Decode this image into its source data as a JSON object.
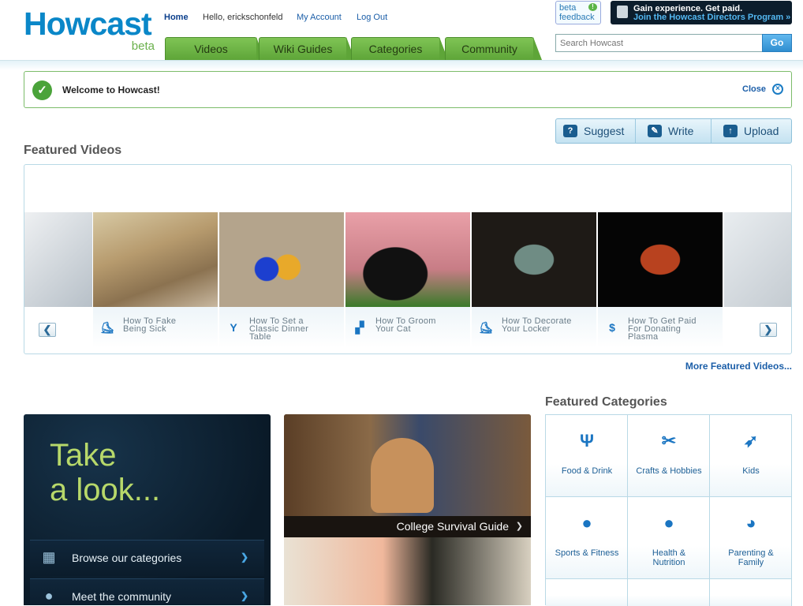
{
  "brand": {
    "name": "Howcast",
    "tag": "beta"
  },
  "topnav": {
    "home": "Home",
    "greeting": "Hello, erickschonfeld",
    "account": "My Account",
    "logout": "Log Out"
  },
  "tabs": [
    {
      "label": "Videos"
    },
    {
      "label": "Wiki Guides"
    },
    {
      "label": "Categories"
    },
    {
      "label": "Community"
    }
  ],
  "feedback": {
    "line1": "beta",
    "line2": "feedback"
  },
  "promo": {
    "line1": "Gain experience. Get paid.",
    "line2": "Join the Howcast Directors Program »"
  },
  "search": {
    "placeholder": "Search Howcast",
    "button": "Go"
  },
  "welcome": {
    "message": "Welcome to Howcast!",
    "close": "Close"
  },
  "actions": [
    {
      "label": "Suggest",
      "icon": "question-icon"
    },
    {
      "label": "Write",
      "icon": "pencil-icon"
    },
    {
      "label": "Upload",
      "icon": "upload-icon"
    }
  ],
  "featured": {
    "title": "Featured Videos",
    "more": "More Featured Videos...",
    "videos": [
      {
        "line1": "How To Fake",
        "line2": "Being Sick",
        "line3": "",
        "icon": "skateboard-icon"
      },
      {
        "line1": "How To Set a",
        "line2": "Classic Dinner",
        "line3": "Table",
        "icon": "glass-icon"
      },
      {
        "line1": "How To Groom",
        "line2": "Your Cat",
        "line3": "",
        "icon": "dog-icon"
      },
      {
        "line1": "How To Decorate",
        "line2": "Your Locker",
        "line3": "",
        "icon": "skateboard-icon"
      },
      {
        "line1": "How To Get Paid",
        "line2": "For Donating",
        "line3": "Plasma",
        "icon": "money-icon"
      }
    ]
  },
  "take_look": {
    "line1": "Take",
    "line2": "a look...",
    "rows": [
      {
        "label": "Browse our categories",
        "icon": "grid-icon"
      },
      {
        "label": "Meet the community",
        "icon": "person-icon"
      }
    ]
  },
  "college": {
    "caption": "College Survival Guide"
  },
  "categories": {
    "title": "Featured Categories",
    "items": [
      {
        "line1": "Food & Drink",
        "line2": "",
        "icon": "fork-knife-icon"
      },
      {
        "line1": "Crafts & Hobbies",
        "line2": "",
        "icon": "scissors-icon"
      },
      {
        "line1": "Kids",
        "line2": "",
        "icon": "rocket-icon"
      },
      {
        "line1": "Sports & Fitness",
        "line2": "",
        "icon": "ball-icon"
      },
      {
        "line1": "Health &",
        "line2": "Nutrition",
        "icon": "apple-icon"
      },
      {
        "line1": "Parenting &",
        "line2": "Family",
        "icon": "stroller-icon"
      }
    ]
  }
}
